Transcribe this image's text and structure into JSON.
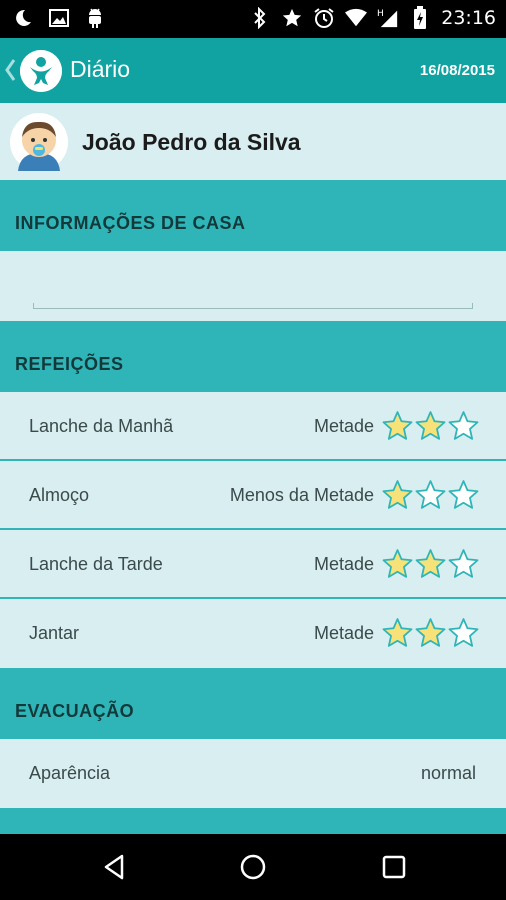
{
  "status_bar": {
    "time": "23:16",
    "left_icons": [
      "moon-icon",
      "image-icon",
      "android-icon"
    ],
    "right_icons": [
      "bluetooth-icon",
      "star-icon",
      "alarm-icon",
      "wifi-icon",
      "signal-icon",
      "battery-icon"
    ]
  },
  "app_bar": {
    "title": "Diário",
    "date": "16/08/2015",
    "accent_color": "#11a3a1"
  },
  "profile": {
    "name": "João Pedro da Silva"
  },
  "sections": {
    "home_info": {
      "title": "INFORMAÇÕES DE CASA"
    },
    "meals": {
      "title": "REFEIÇÕES",
      "items": [
        {
          "label": "Lanche da Manhã",
          "value": "Metade",
          "rating": 2,
          "max": 3
        },
        {
          "label": "Almoço",
          "value": "Menos da Metade",
          "rating": 1,
          "max": 3
        },
        {
          "label": "Lanche da Tarde",
          "value": "Metade",
          "rating": 2,
          "max": 3
        },
        {
          "label": "Jantar",
          "value": "Metade",
          "rating": 2,
          "max": 3
        }
      ]
    },
    "evacuation": {
      "title": "EVACUAÇÃO",
      "items": [
        {
          "label": "Aparência",
          "value": "normal"
        }
      ]
    }
  },
  "colors": {
    "section_header": "#2fb5b8",
    "background": "#d9eef0",
    "star_filled": "#f7e27a",
    "star_outline": "#2fb5b8"
  }
}
